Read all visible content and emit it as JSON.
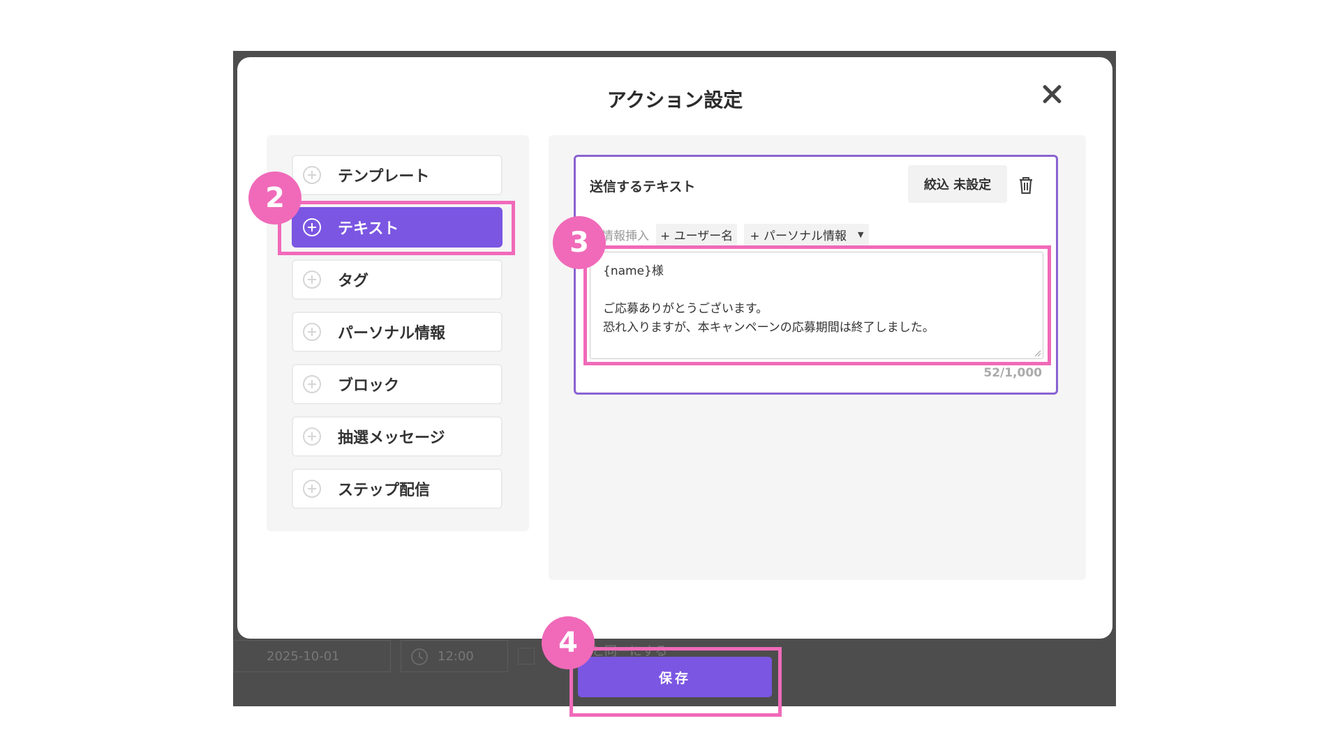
{
  "modal": {
    "title": "アクション設定",
    "close_icon": "close-icon"
  },
  "menu": {
    "items": [
      {
        "label": "テンプレート",
        "active": false
      },
      {
        "label": "テキスト",
        "active": true
      },
      {
        "label": "タグ",
        "active": false
      },
      {
        "label": "パーソナル情報",
        "active": false
      },
      {
        "label": "ブロック",
        "active": false
      },
      {
        "label": "抽選メッセージ",
        "active": false
      },
      {
        "label": "ステップ配信",
        "active": false
      }
    ],
    "item_icon": "plus-circle-icon"
  },
  "text_card": {
    "title": "送信するテキスト",
    "filter_label": "絞込 未設定",
    "delete_icon": "trash-icon",
    "insert_label": "動情報挿入",
    "insert_user": "+ ユーザー名",
    "insert_personal": "+ パーソナル情報",
    "message_lines": [
      "{name}様",
      "",
      "ご応募ありがとうございます。",
      "恐れ入りますが、本キャンペーンの応募期間は終了しました。"
    ],
    "counter": "52/1,000"
  },
  "footer": {
    "save_label": "保存"
  },
  "background": {
    "date": "2025-10-01",
    "time": "12:00",
    "partial_text": "と同一にする"
  },
  "annotations": {
    "step2": "2",
    "step3": "3",
    "step4": "4"
  },
  "colors": {
    "accent": "#7b56e2",
    "highlight": "#f06ab9",
    "card_border": "#8a63d2",
    "backdrop": "#4d4d4d"
  }
}
